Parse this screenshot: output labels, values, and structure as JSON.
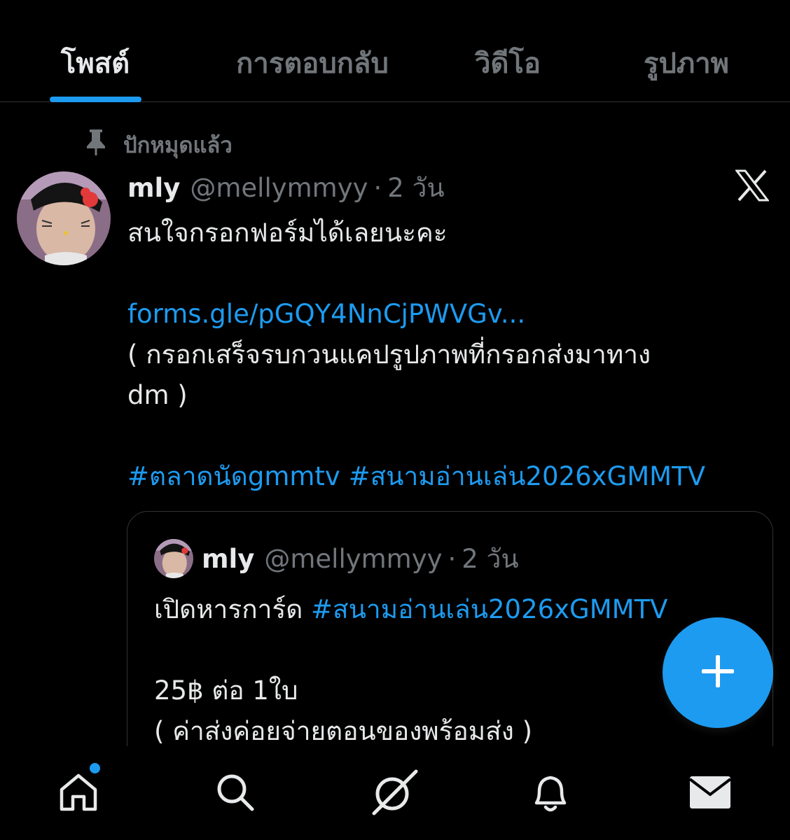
{
  "tabs": [
    {
      "label": "โพสต์",
      "active": true
    },
    {
      "label": "การตอบกลับ",
      "active": false
    },
    {
      "label": "วิดีโอ",
      "active": false
    },
    {
      "label": "รูปภาพ",
      "active": false
    }
  ],
  "pinned_label": "ปักหมุดแล้ว",
  "post": {
    "name": "mly",
    "handle": "@mellymmyy",
    "separator": "·",
    "time": "2 วัน",
    "lines": [
      "สนใจกรอกฟอร์มได้เลยนะคะ",
      "",
      "forms.gle/pGQY4NnCjPWVGv...",
      "( กรอกเสร็จรบกวนแคปรูปภาพที่กรอกส่งมาทาง",
      "dm )",
      "",
      "#ตลาดนัดgmmtv #สนามอ่านเล่น2026xGMMTV"
    ]
  },
  "quote": {
    "name": "mly",
    "handle": "@mellymmyy",
    "separator": "·",
    "time": "2 วัน",
    "line1_text": "เปิดหารการ์ด ",
    "line1_hashtag": "#สนามอ่านเล่น2026xGMMTV",
    "line2": "",
    "line3": "25฿ ต่อ 1ใบ",
    "line4": "( ค่าส่งค่อยจ่ายตอนของพร้อมส่ง )"
  },
  "icons": {
    "pin": "pin-icon",
    "x_logo": "x-logo-icon",
    "fab": "plus-icon",
    "nav": [
      "home-icon",
      "search-icon",
      "grok-icon",
      "bell-icon",
      "mail-icon"
    ]
  },
  "colors": {
    "background": "#000000",
    "text": "#e7e9ea",
    "muted": "#71767b",
    "accent": "#1d9bf0",
    "border": "#2f3336"
  }
}
